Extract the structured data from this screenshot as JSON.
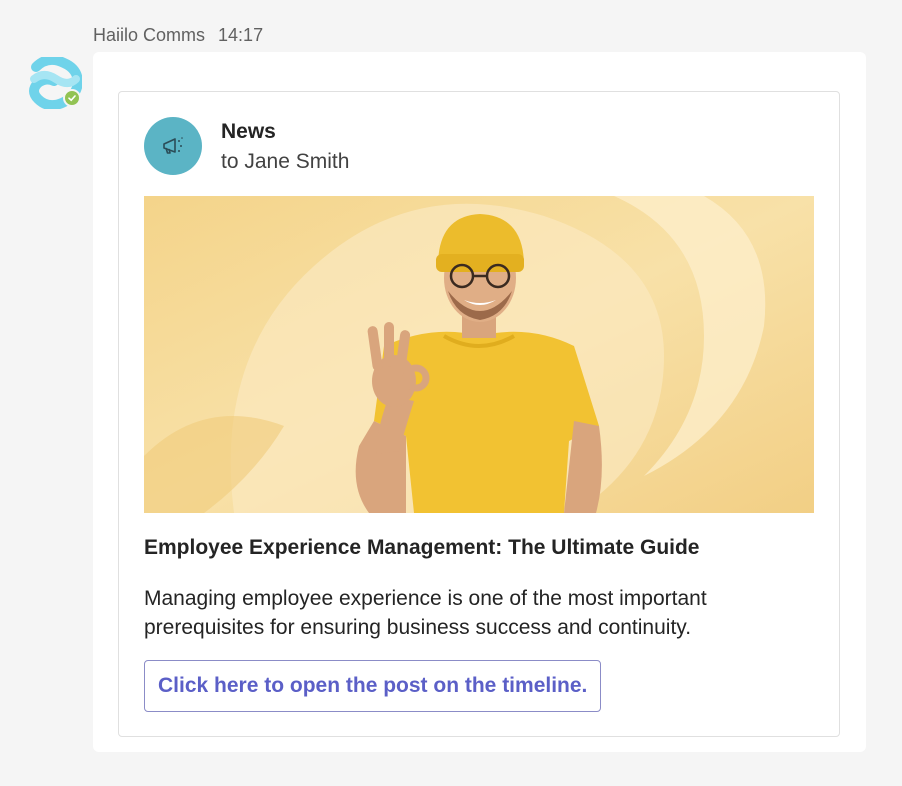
{
  "message": {
    "sender": "Haiilo Comms",
    "time": "14:17",
    "presence": "available"
  },
  "card": {
    "icon": "megaphone-icon",
    "title": "News",
    "recipient": "to Jane Smith",
    "image": "smiling man in yellow beanie and yellow t-shirt making OK hand gesture",
    "post_title": "Employee Experience Management: The Ultimate Guide",
    "post_excerpt": "Managing employee experience is one of the most important prerequisites for ensuring business success and continuity.",
    "open_button_label": "Click here to open the post on the timeline."
  },
  "colors": {
    "app_background": "#f5f5f5",
    "card_icon_bg": "#5bb4c5",
    "button_accent": "#5b5fc7",
    "presence_green": "#92c353",
    "hero_background": "#f6d98f"
  }
}
